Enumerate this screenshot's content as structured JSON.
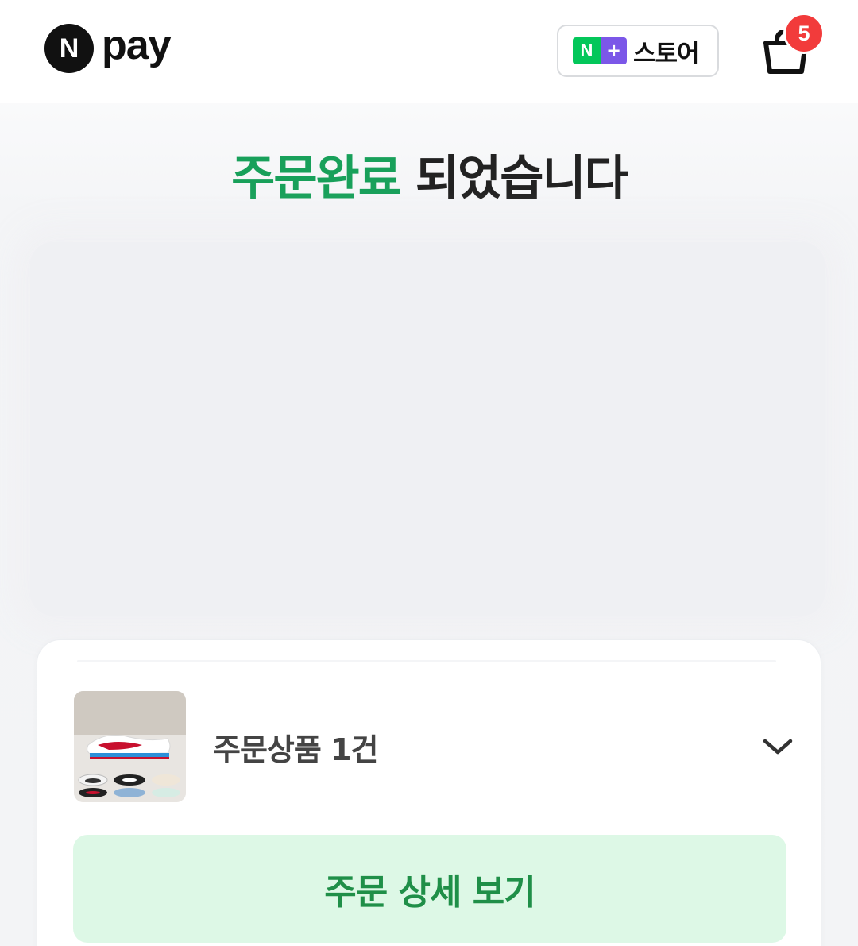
{
  "header": {
    "logo_text": "pay",
    "logo_letter": "N",
    "store_badge_letter": "N",
    "store_badge_plus": "+",
    "store_label": "스토어",
    "cart_count": "5"
  },
  "title": {
    "accent": "주문완료",
    "rest": " 되었습니다"
  },
  "order": {
    "product_summary": "주문상품 1건",
    "detail_button": "주문 상세 보기"
  },
  "colors": {
    "accent_green": "#18a05a",
    "naver_green": "#03c75a",
    "plus_purple": "#7b57e8",
    "badge_red": "#f23b3b",
    "button_bg": "#ddf8e6"
  },
  "icons": {
    "cart": "shopping-bag-icon",
    "expand": "chevron-down-icon"
  }
}
